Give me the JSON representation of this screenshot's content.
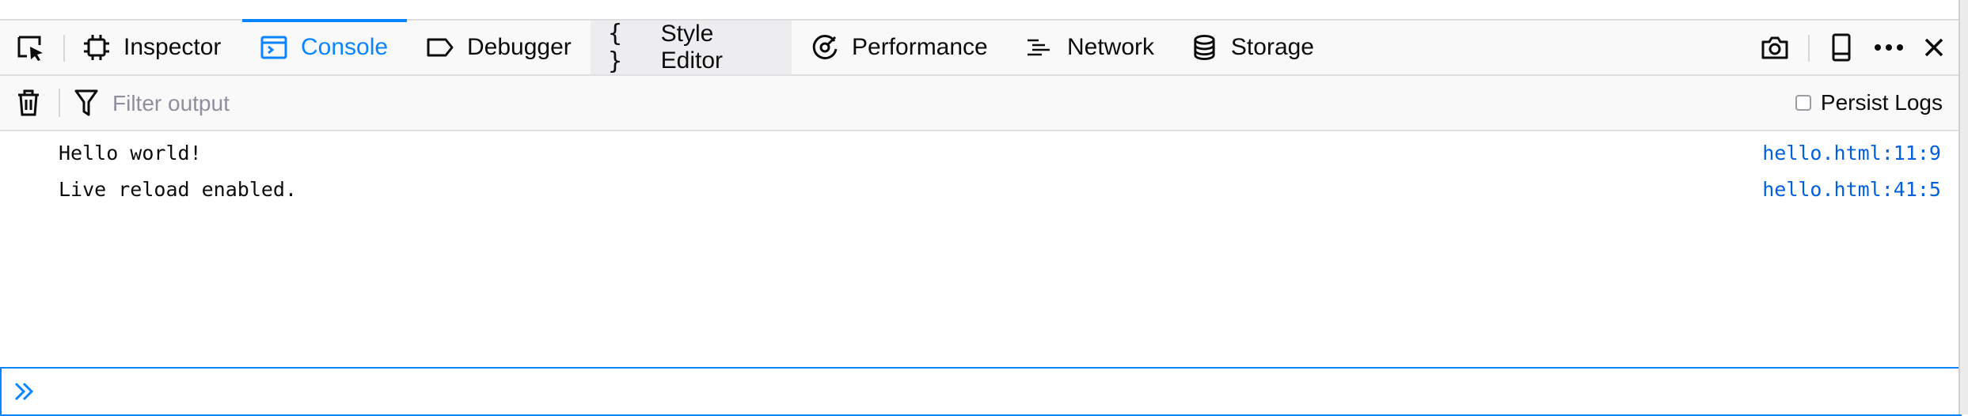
{
  "toolbar": {
    "tabs": [
      {
        "label": "Inspector"
      },
      {
        "label": "Console"
      },
      {
        "label": "Debugger"
      },
      {
        "label": "Style Editor"
      },
      {
        "label": "Performance"
      },
      {
        "label": "Network"
      },
      {
        "label": "Storage"
      }
    ],
    "selected_tab": "Console",
    "icons": [
      "element-picker-icon",
      "screenshot-camera-icon",
      "responsive-design-icon",
      "more-options-icon",
      "close-icon"
    ]
  },
  "filterbar": {
    "filter_placeholder": "Filter output",
    "persist_logs_label": "Persist Logs",
    "persist_logs_checked": false
  },
  "console": {
    "messages": [
      {
        "text": "Hello world!",
        "location": "hello.html:11:9"
      },
      {
        "text": "Live reload enabled.",
        "location": "hello.html:41:5"
      }
    ],
    "prompt_value": ""
  },
  "colors": {
    "accent": "#0a84ff",
    "link": "#0060df",
    "toolbar_bg": "#f9f9fa"
  }
}
